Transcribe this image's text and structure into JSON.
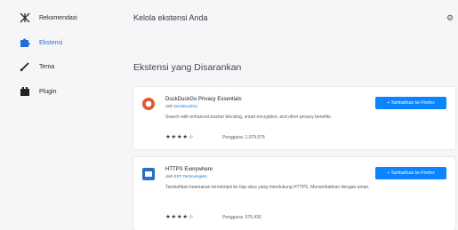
{
  "sidebar": {
    "items": [
      {
        "label": "Rekomendasi",
        "icon": "sparkle-icon"
      },
      {
        "label": "Ekstensi",
        "icon": "puzzle-icon",
        "active": true
      },
      {
        "label": "Tema",
        "icon": "brush-icon"
      },
      {
        "label": "Plugin",
        "icon": "plugin-block-icon"
      }
    ]
  },
  "header": {
    "title": "Kelola ekstensi Anda",
    "settings_icon": "gear-icon"
  },
  "section": {
    "title": "Ekstensi yang Disarankan"
  },
  "extensions": [
    {
      "name": "DuckDuckGo Privacy Essentials",
      "author_prefix": "oleh",
      "author": "DuckDuckGo",
      "description": "Search with enhanced tracker blocking, smart encryption, and other privacy benefits.",
      "stars": "★★★★☆",
      "users": "Pengguna: 1.079.075",
      "button": "+ Tambahkan ke Firefox",
      "icon_color": "#de5833"
    },
    {
      "name": "HTTPS Everywhere",
      "author_prefix": "oleh",
      "author": "EFF Technologists",
      "description": "Tambahkan keamanan terenkripsi ke tiap situs yang mendukung HTTPS. Menambahkan dengan aman.",
      "stars": "★★★★☆",
      "users": "Pengguna: 576.430",
      "button": "+ Tambahkan ke Firefox",
      "icon_color": "#2a6fc1"
    }
  ]
}
